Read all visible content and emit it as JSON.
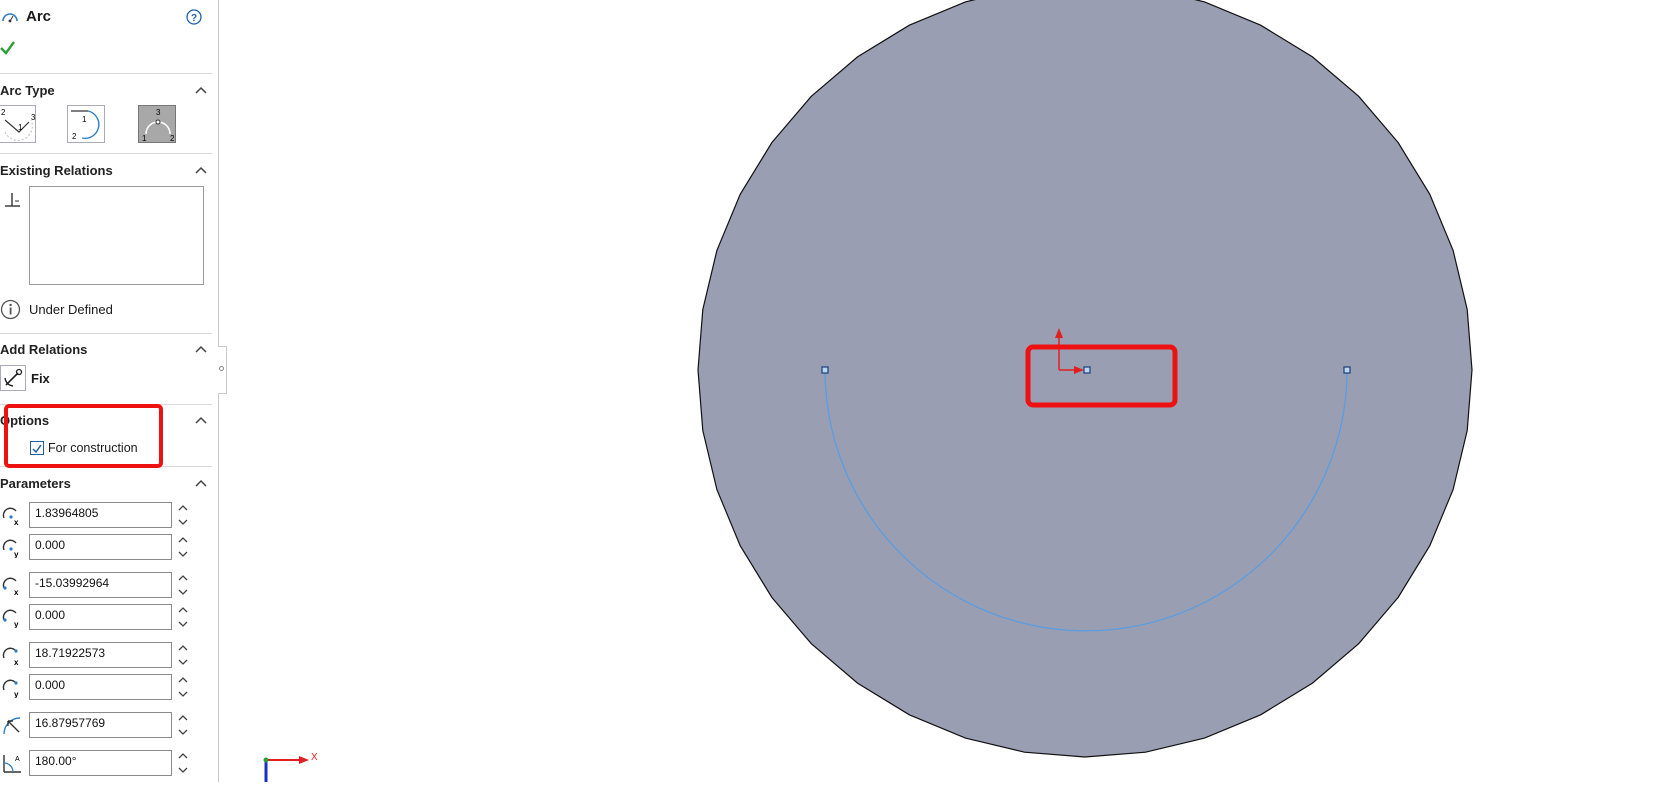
{
  "panel": {
    "title": "Arc",
    "sections": {
      "arc_type": "Arc Type",
      "existing_relations": "Existing Relations",
      "add_relations": "Add Relations",
      "options": "Options",
      "parameters": "Parameters"
    },
    "arc_type_buttons": [
      {
        "name": "Center Point Arc",
        "badge": [
          "1",
          "2",
          "3"
        ]
      },
      {
        "name": "Tangent Arc",
        "badge": [
          "1",
          "2"
        ]
      },
      {
        "name": "3 Point Arc",
        "badge": [
          "1",
          "2",
          "3"
        ],
        "selected": true
      }
    ],
    "status": "Under Defined",
    "fix_label": "Fix",
    "for_construction_label": "For construction",
    "for_construction_checked": true,
    "parameters": {
      "center_x": "1.83964805",
      "center_y": "0.000",
      "start_x": "-15.03992964",
      "start_y": "0.000",
      "end_x": "18.71922573",
      "end_y": "0.000",
      "radius": "16.87957769",
      "angle": "180.00°"
    }
  },
  "viewport": {
    "triad_x_label": "X",
    "sketch_fill": "#9a9eb3",
    "arc_color": "#5a9de0",
    "highlight_color": "#ee1111"
  }
}
